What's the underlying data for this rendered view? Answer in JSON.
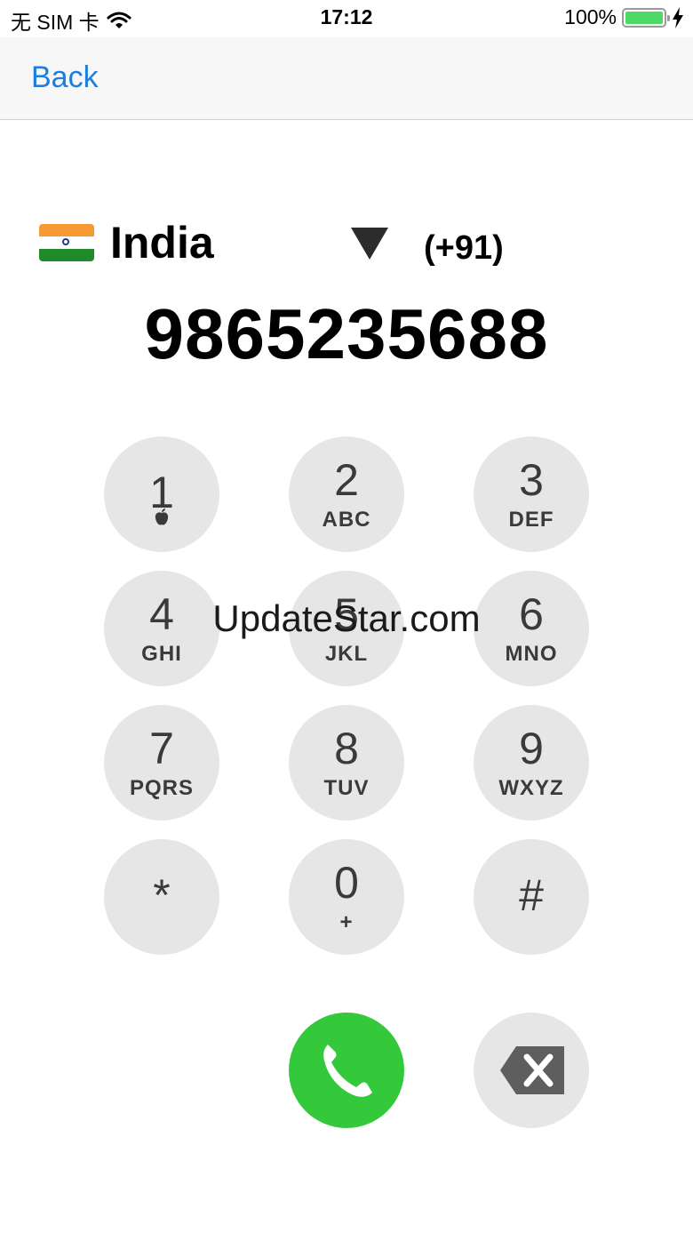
{
  "status_bar": {
    "carrier": "无 SIM 卡",
    "time": "17:12",
    "battery_percent": "100%",
    "battery_level": 1.0,
    "wifi_icon": "wifi-icon",
    "charging_icon": "bolt-icon"
  },
  "nav": {
    "back_label": "Back"
  },
  "country": {
    "flag_icon": "india-flag-icon",
    "name": "India",
    "code": "(+91)"
  },
  "phone_number": "9865235688",
  "keypad": [
    {
      "digit": "1",
      "letters": ""
    },
    {
      "digit": "2",
      "letters": "ABC"
    },
    {
      "digit": "3",
      "letters": "DEF"
    },
    {
      "digit": "4",
      "letters": "GHI"
    },
    {
      "digit": "5",
      "letters": "JKL"
    },
    {
      "digit": "6",
      "letters": "MNO"
    },
    {
      "digit": "7",
      "letters": "PQRS"
    },
    {
      "digit": "8",
      "letters": "TUV"
    },
    {
      "digit": "9",
      "letters": "WXYZ"
    },
    {
      "digit": "*",
      "letters": ""
    },
    {
      "digit": "0",
      "letters": "+"
    },
    {
      "digit": "#",
      "letters": ""
    }
  ],
  "call_icon": "phone-icon",
  "delete_icon": "backspace-icon",
  "watermark": "UpdateStar.com",
  "colors": {
    "accent": "#1a7fe0",
    "call": "#34c93b",
    "key_bg": "#e6e6e6"
  }
}
